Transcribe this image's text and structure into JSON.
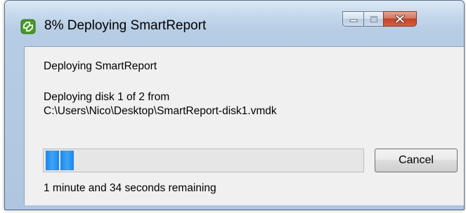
{
  "window": {
    "title": "8% Deploying SmartReport",
    "icon": "vsphere-app-icon",
    "controls": {
      "minimize": "minimize-icon",
      "maximize": "maximize-icon",
      "close": "close-icon"
    }
  },
  "dialog": {
    "heading": "Deploying SmartReport",
    "status_line1": "Deploying disk 1 of 2 from",
    "status_line2": "C:\\Users\\Nico\\Desktop\\SmartReport-disk1.vmdk",
    "progress_percent": 8,
    "time_remaining": "1 minute and 34 seconds remaining",
    "cancel_label": "Cancel"
  },
  "colors": {
    "progress_fill": "#1a86e8",
    "close_button": "#c2432a",
    "titlebar": "#c6d9ec",
    "client_background": "#f0f0f0"
  }
}
